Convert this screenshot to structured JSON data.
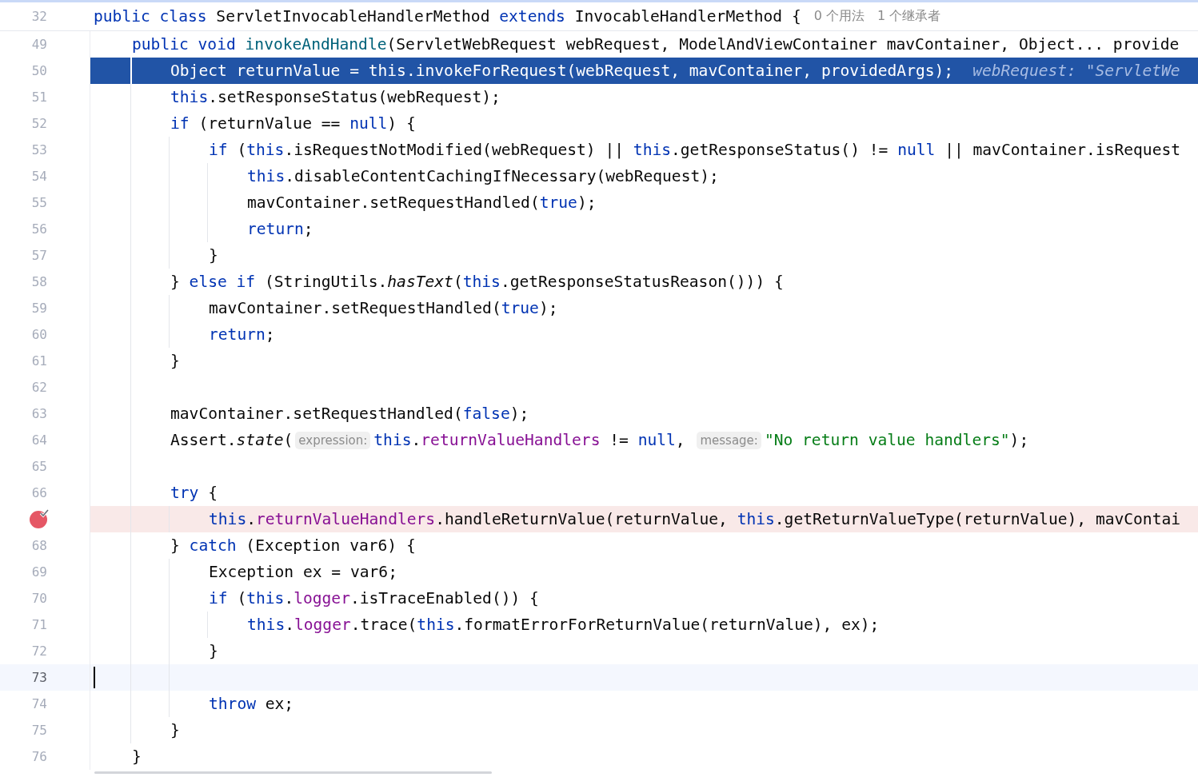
{
  "code": {
    "number": "32",
    "tokens": [
      {
        "text": "public class",
        "kind": "kw"
      },
      {
        "text": " ServletInvocableHandlerMethod ",
        "kind": "plain"
      },
      {
        "text": "extends",
        "kind": "kw"
      },
      {
        "text": " InvocableHandlerMethod {",
        "kind": "plain"
      },
      {
        "text": "0 个用法",
        "kind": "usage"
      },
      {
        "text": "1 个继承者",
        "kind": "usage"
      }
    ],
    "children": [
      {
        "number": "49",
        "tokens": [
          {
            "text": "public void ",
            "kind": "kw"
          },
          {
            "text": "invokeAndHandle",
            "kind": "decl"
          },
          {
            "text": "(ServletWebRequest webRequest, ModelAndViewContainer mavContainer, Object... provide",
            "kind": "plain"
          }
        ],
        "children": [
          {
            "number": "50",
            "kind": "execution",
            "tokens": [
              {
                "text": "Object returnValue = ",
                "kind": "plain"
              },
              {
                "text": "this",
                "kind": "kw"
              },
              {
                "text": ".invokeForRequest(webRequest, mavContainer, providedArgs);",
                "kind": "plain"
              },
              {
                "text": "webRequest: \"ServletWe",
                "kind": "inline"
              }
            ]
          },
          {
            "number": "51",
            "tokens": [
              {
                "text": "this",
                "kind": "kw"
              },
              {
                "text": ".setResponseStatus(webRequest);",
                "kind": "plain"
              }
            ]
          },
          {
            "number": "52",
            "tokens": [
              {
                "text": "if ",
                "kind": "kw"
              },
              {
                "text": "(returnValue == ",
                "kind": "plain"
              },
              {
                "text": "null",
                "kind": "kw"
              },
              {
                "text": ") {",
                "kind": "plain"
              }
            ],
            "children": [
              {
                "number": "53",
                "tokens": [
                  {
                    "text": "if ",
                    "kind": "kw"
                  },
                  {
                    "text": "(",
                    "kind": "plain"
                  },
                  {
                    "text": "this",
                    "kind": "kw"
                  },
                  {
                    "text": ".isRequestNotModified(webRequest) || ",
                    "kind": "plain"
                  },
                  {
                    "text": "this",
                    "kind": "kw"
                  },
                  {
                    "text": ".getResponseStatus() != ",
                    "kind": "plain"
                  },
                  {
                    "text": "null",
                    "kind": "kw"
                  },
                  {
                    "text": " || mavContainer.isRequest",
                    "kind": "plain"
                  }
                ],
                "children": [
                  {
                    "number": "54",
                    "tokens": [
                      {
                        "text": "this",
                        "kind": "kw"
                      },
                      {
                        "text": ".disableContentCachingIfNecessary(webRequest);",
                        "kind": "plain"
                      }
                    ]
                  },
                  {
                    "number": "55",
                    "tokens": [
                      {
                        "text": "mavContainer.setRequestHandled(",
                        "kind": "plain"
                      },
                      {
                        "text": "true",
                        "kind": "kw"
                      },
                      {
                        "text": ");",
                        "kind": "plain"
                      }
                    ]
                  },
                  {
                    "number": "56",
                    "tokens": [
                      {
                        "text": "return",
                        "kind": "kw"
                      },
                      {
                        "text": ";",
                        "kind": "plain"
                      }
                    ]
                  }
                ]
              },
              {
                "number": "57",
                "tokens": [
                  {
                    "text": "}",
                    "kind": "plain"
                  }
                ]
              }
            ]
          },
          {
            "number": "58",
            "tokens": [
              {
                "text": "} ",
                "kind": "plain"
              },
              {
                "text": "else if ",
                "kind": "kw"
              },
              {
                "text": "(StringUtils.",
                "kind": "plain"
              },
              {
                "text": "hasText",
                "kind": "static"
              },
              {
                "text": "(",
                "kind": "plain"
              },
              {
                "text": "this",
                "kind": "kw"
              },
              {
                "text": ".getResponseStatusReason())) {",
                "kind": "plain"
              }
            ],
            "children": [
              {
                "number": "59",
                "tokens": [
                  {
                    "text": "mavContainer.setRequestHandled(",
                    "kind": "plain"
                  },
                  {
                    "text": "true",
                    "kind": "kw"
                  },
                  {
                    "text": ");",
                    "kind": "plain"
                  }
                ]
              },
              {
                "number": "60",
                "tokens": [
                  {
                    "text": "return",
                    "kind": "kw"
                  },
                  {
                    "text": ";",
                    "kind": "plain"
                  }
                ]
              }
            ]
          },
          {
            "number": "61",
            "tokens": [
              {
                "text": "}",
                "kind": "plain"
              }
            ]
          },
          {
            "number": "62"
          },
          {
            "number": "63",
            "tokens": [
              {
                "text": "mavContainer.setRequestHandled(",
                "kind": "plain"
              },
              {
                "text": "false",
                "kind": "kw"
              },
              {
                "text": ");",
                "kind": "plain"
              }
            ]
          },
          {
            "number": "64",
            "tokens": [
              {
                "text": "Assert.",
                "kind": "plain"
              },
              {
                "text": "state",
                "kind": "static"
              },
              {
                "text": "(",
                "kind": "plain"
              },
              {
                "text": "expression:",
                "kind": "hint"
              },
              {
                "text": "this",
                "kind": "kw"
              },
              {
                "text": ".returnValueHandlers",
                "kind": "member"
              },
              {
                "text": " != ",
                "kind": "plain"
              },
              {
                "text": "null",
                "kind": "kw"
              },
              {
                "text": ", ",
                "kind": "plain"
              },
              {
                "text": "message:",
                "kind": "hint"
              },
              {
                "text": "\"No return value handlers\"",
                "kind": "str"
              },
              {
                "text": ");",
                "kind": "plain"
              }
            ]
          },
          {
            "number": "65"
          },
          {
            "number": "66",
            "tokens": [
              {
                "text": "try",
                "kind": "kw"
              },
              {
                "text": " {",
                "kind": "plain"
              }
            ],
            "children": [
              {
                "kind": "breakpoint",
                "tokens": [
                  {
                    "text": "this",
                    "kind": "kw"
                  },
                  {
                    "text": ".returnValueHandlers",
                    "kind": "member"
                  },
                  {
                    "text": ".handleReturnValue(returnValue, ",
                    "kind": "plain"
                  },
                  {
                    "text": "this",
                    "kind": "kw"
                  },
                  {
                    "text": ".getReturnValueType(returnValue), mavContai",
                    "kind": "plain"
                  }
                ]
              }
            ]
          },
          {
            "number": "68",
            "tokens": [
              {
                "text": "} ",
                "kind": "plain"
              },
              {
                "text": "catch",
                "kind": "kw"
              },
              {
                "text": " (Exception var6) {",
                "kind": "plain"
              }
            ],
            "children": [
              {
                "number": "69",
                "tokens": [
                  {
                    "text": "Exception ex = var6;",
                    "kind": "plain"
                  }
                ]
              },
              {
                "number": "70",
                "tokens": [
                  {
                    "text": "if ",
                    "kind": "kw"
                  },
                  {
                    "text": "(",
                    "kind": "plain"
                  },
                  {
                    "text": "this",
                    "kind": "kw"
                  },
                  {
                    "text": ".logger",
                    "kind": "member"
                  },
                  {
                    "text": ".isTraceEnabled()) {",
                    "kind": "plain"
                  }
                ],
                "children": [
                  {
                    "number": "71",
                    "tokens": [
                      {
                        "text": "this",
                        "kind": "kw"
                      },
                      {
                        "text": ".logger",
                        "kind": "member"
                      },
                      {
                        "text": ".trace(",
                        "kind": "plain"
                      },
                      {
                        "text": "this",
                        "kind": "kw"
                      },
                      {
                        "text": ".formatErrorForReturnValue(returnValue), ex);",
                        "kind": "plain"
                      }
                    ]
                  }
                ]
              },
              {
                "number": "72",
                "tokens": [
                  {
                    "text": "}",
                    "kind": "plain"
                  }
                ]
              },
              {
                "number": "73",
                "kind": "caret"
              },
              {
                "number": "74",
                "tokens": [
                  {
                    "text": "throw",
                    "kind": "kw"
                  },
                  {
                    "text": " ex;",
                    "kind": "plain"
                  }
                ]
              }
            ]
          },
          {
            "number": "75",
            "tokens": [
              {
                "text": "}",
                "kind": "plain"
              }
            ]
          }
        ]
      },
      {
        "number": "76",
        "tokens": [
          {
            "text": "}",
            "kind": "plain"
          }
        ]
      }
    ]
  }
}
